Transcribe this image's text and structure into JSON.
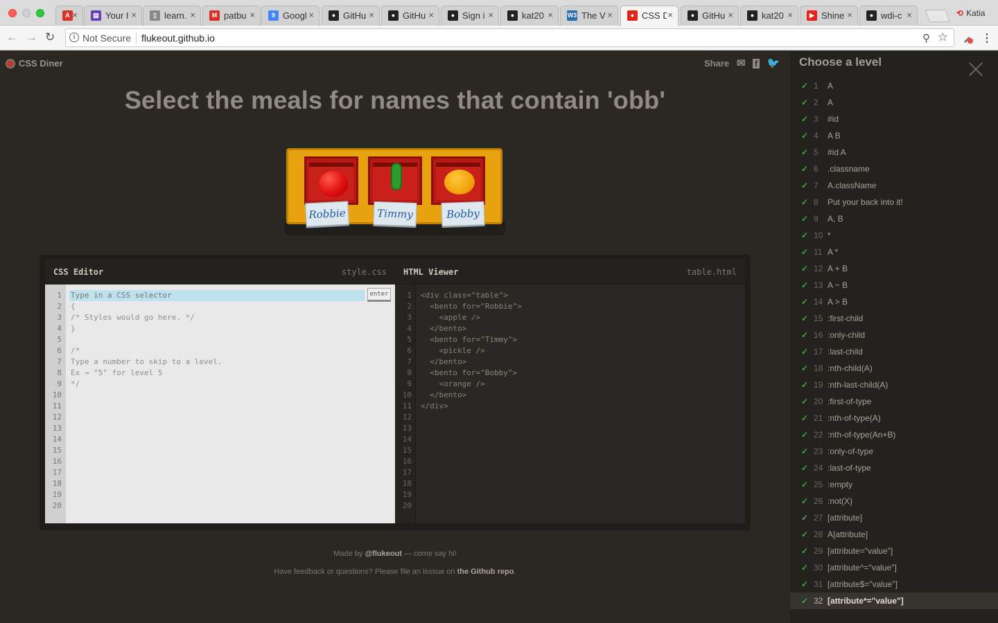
{
  "browser": {
    "tabs": [
      {
        "label": "",
        "icon": "app-icon",
        "color": "#d9342b",
        "glyph": "A",
        "left": 0
      },
      {
        "label": "Your I",
        "icon": "form-icon",
        "color": "#6a3fb5",
        "glyph": "▤"
      },
      {
        "label": "learn.",
        "icon": "document-icon",
        "color": "#888888",
        "glyph": "▯"
      },
      {
        "label": "patbu",
        "icon": "gmail-icon",
        "color": "#d93025",
        "glyph": "M"
      },
      {
        "label": "Googl",
        "icon": "calendar-icon",
        "color": "#4285f4",
        "glyph": "9"
      },
      {
        "label": "GitHu",
        "icon": "github-icon",
        "color": "#222222",
        "glyph": "●"
      },
      {
        "label": "GitHu",
        "icon": "github-icon",
        "color": "#222222",
        "glyph": "●"
      },
      {
        "label": "Sign i",
        "icon": "github-icon",
        "color": "#222222",
        "glyph": "●"
      },
      {
        "label": "kat20",
        "icon": "github-icon",
        "color": "#222222",
        "glyph": "●"
      },
      {
        "label": "The V",
        "icon": "w3schools-icon",
        "color": "#2b6cb0",
        "glyph": "W3"
      },
      {
        "label": "CSS D",
        "icon": "css-diner-icon",
        "color": "#e0261b",
        "glyph": "●",
        "active": true
      },
      {
        "label": "GitHu",
        "icon": "github-icon",
        "color": "#222222",
        "glyph": "●"
      },
      {
        "label": "kat20",
        "icon": "github-icon",
        "color": "#222222",
        "glyph": "●"
      },
      {
        "label": "Shine",
        "icon": "youtube-icon",
        "color": "#e62117",
        "glyph": "▶"
      },
      {
        "label": "wdi-c",
        "icon": "github-icon",
        "color": "#222222",
        "glyph": "●"
      }
    ],
    "profile_name": "Katia",
    "security_label": "Not Secure",
    "url": "flukeout.github.io"
  },
  "page": {
    "logo_text": "CSS Diner",
    "share_label": "Share",
    "headline": "Select the meals for names that contain 'obb'",
    "bentos": [
      {
        "name": "Robbie",
        "food": "apple"
      },
      {
        "name": "Timmy",
        "food": "pickle"
      },
      {
        "name": "Bobby",
        "food": "orange"
      }
    ],
    "css_editor": {
      "title": "CSS Editor",
      "file": "style.css",
      "placeholder": "Type in a CSS selector",
      "enter_label": "enter",
      "code": "{\n/* Styles would go here. */\n}\n\n/*\nType a number to skip to a level.\nEx → \"5\" for level 5\n*/"
    },
    "html_viewer": {
      "title": "HTML Viewer",
      "file": "table.html",
      "code": "<div class=\"table\">\n  <bento for=\"Robbie\">\n    <apple />\n  </bento>\n  <bento for=\"Timmy\">\n    <pickle />\n  </bento>\n  <bento for=\"Bobby\">\n    <orange />\n  </bento>\n</div>"
    },
    "line_numbers": "1\n2\n3\n4\n5\n6\n7\n8\n9\n10\n11\n12\n13\n14\n15\n16\n17\n18\n19\n20",
    "credits": {
      "made_by_prefix": "Made by ",
      "made_by_handle": "@flukeout",
      "made_by_suffix": " — come say hi!",
      "feedback_prefix": "Have feedback or questions? Please file an isssue on ",
      "feedback_link": "the Github repo",
      "feedback_suffix": "."
    }
  },
  "sidebar": {
    "title": "Choose a level",
    "levels": [
      {
        "num": "1",
        "label": "A"
      },
      {
        "num": "2",
        "label": "A"
      },
      {
        "num": "3",
        "label": "#id"
      },
      {
        "num": "4",
        "label": "A  B"
      },
      {
        "num": "5",
        "label": "#id  A"
      },
      {
        "num": "6",
        "label": ".classname"
      },
      {
        "num": "7",
        "label": "A.className"
      },
      {
        "num": "8",
        "label": "Put your back into it!"
      },
      {
        "num": "9",
        "label": "A, B"
      },
      {
        "num": "10",
        "label": "*"
      },
      {
        "num": "11",
        "label": "A  *"
      },
      {
        "num": "12",
        "label": "A + B"
      },
      {
        "num": "13",
        "label": "A ~ B"
      },
      {
        "num": "14",
        "label": "A > B"
      },
      {
        "num": "15",
        "label": ":first-child"
      },
      {
        "num": "16",
        "label": ":only-child"
      },
      {
        "num": "17",
        "label": ":last-child"
      },
      {
        "num": "18",
        "label": ":nth-child(A)"
      },
      {
        "num": "19",
        "label": ":nth-last-child(A)"
      },
      {
        "num": "20",
        "label": ":first-of-type"
      },
      {
        "num": "21",
        "label": ":nth-of-type(A)"
      },
      {
        "num": "22",
        "label": ":nth-of-type(An+B)"
      },
      {
        "num": "23",
        "label": ":only-of-type"
      },
      {
        "num": "24",
        "label": ":last-of-type"
      },
      {
        "num": "25",
        "label": ":empty"
      },
      {
        "num": "26",
        "label": ":not(X)"
      },
      {
        "num": "27",
        "label": "[attribute]"
      },
      {
        "num": "28",
        "label": "A[attribute]"
      },
      {
        "num": "29",
        "label": "[attribute=\"value\"]"
      },
      {
        "num": "30",
        "label": "[attribute^=\"value\"]"
      },
      {
        "num": "31",
        "label": "[attribute$=\"value\"]"
      },
      {
        "num": "32",
        "label": "[attribute*=\"value\"]"
      }
    ],
    "current_level": "32"
  }
}
